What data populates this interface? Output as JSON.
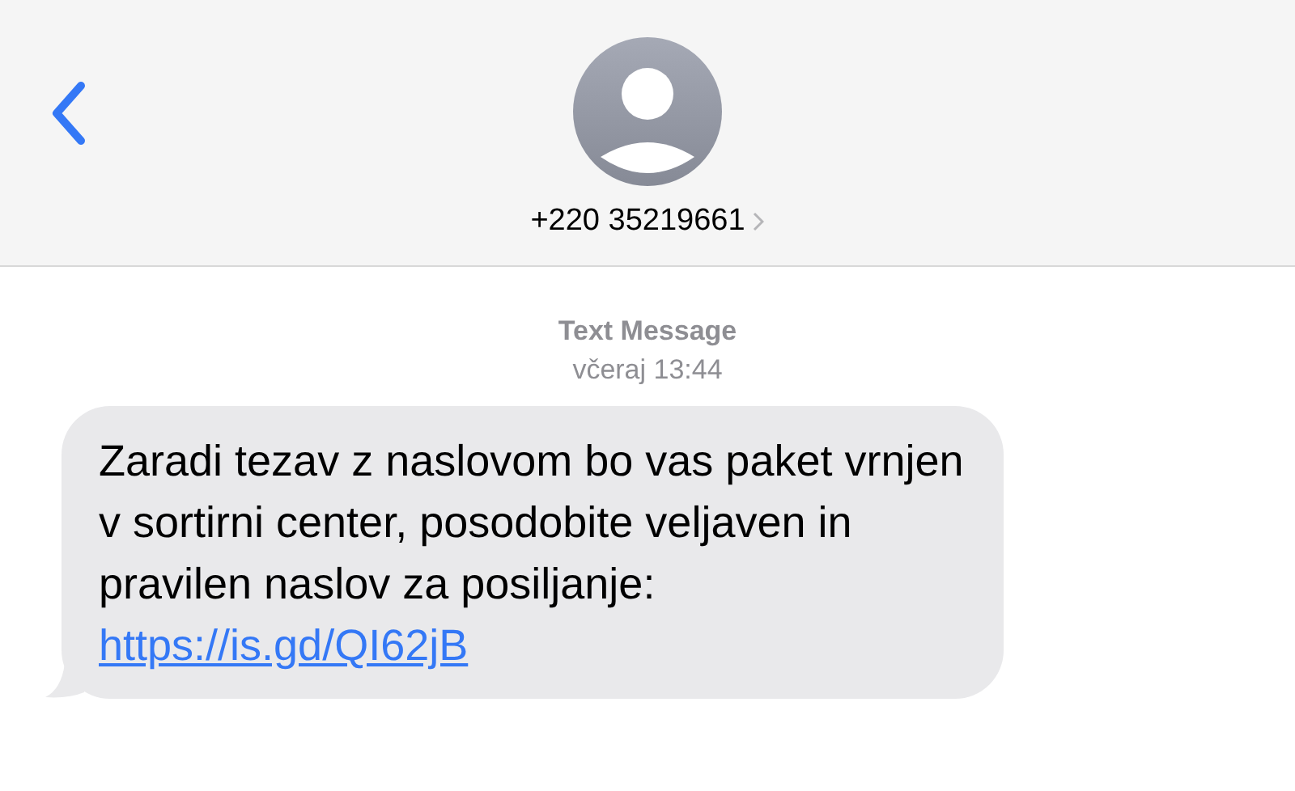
{
  "header": {
    "contact": "+220 35219661"
  },
  "message_meta": {
    "service": "Text Message",
    "time": "včeraj 13:44"
  },
  "message": {
    "text": "Zaradi tezav z naslovom bo vas paket vrnjen v sortirni center, posodobite veljaven in pravilen naslov za posiljanje: ",
    "link": "https://is.gd/QI62jB"
  }
}
